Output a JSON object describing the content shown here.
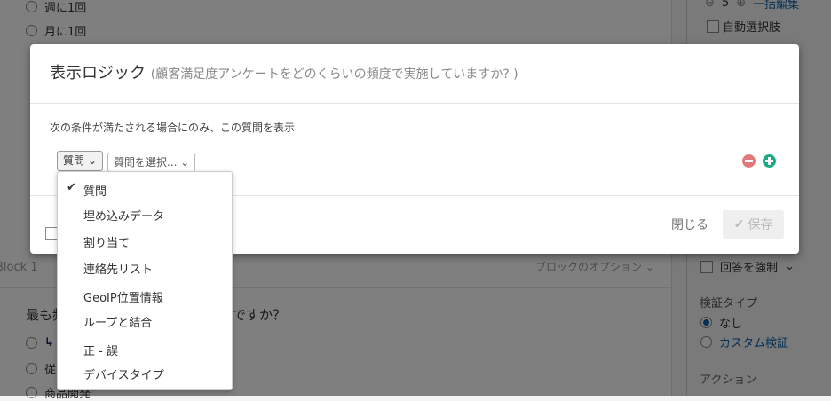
{
  "background": {
    "choices_top": [
      "週に1回",
      "月に1回"
    ],
    "count_value": "5",
    "bulk_edit": "一括編集",
    "auto_choices": "自動選択肢",
    "block_name": "Block 1",
    "block_options": "ブロックのオプション",
    "question_start": "最も頻",
    "question_end": "ですか？",
    "choices_bottom": [
      "従",
      "商品開発"
    ],
    "force_response": "回答を強制",
    "validation_type": "検証タイプ",
    "validation_none": "なし",
    "validation_custom": "カスタム検証",
    "actions": "アクション"
  },
  "modal": {
    "title": "表示ロジック",
    "subtitle": "(顧客満足度アンケートをどのくらいの頻度で実施していますか? )",
    "condition_text": "次の条件が満たされる場合にのみ、この質問を表示",
    "type_select": "質問",
    "question_select": "質問を選択...",
    "close": "閉じる",
    "save": "保存",
    "colors": {
      "remove": "#e07a7a",
      "add": "#1aab84"
    }
  },
  "dropdown": {
    "selected": "質問",
    "items": [
      "質問",
      "埋め込みデータ",
      "割り当て",
      "連絡先リスト",
      "GeoIP位置情報",
      "ループと結合",
      "正 - 誤",
      "デバイスタイプ"
    ]
  }
}
